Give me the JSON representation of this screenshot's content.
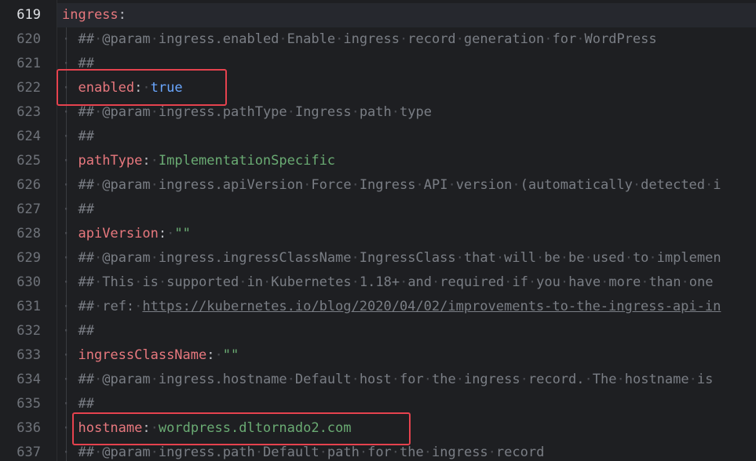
{
  "current_line": 619,
  "lines": [
    {
      "num": "619",
      "key": "ingress",
      "colon": ":",
      "indent": ""
    },
    {
      "num": "620",
      "comment": "## @param ingress.enabled Enable ingress record generation for WordPress"
    },
    {
      "num": "621",
      "comment": "##"
    },
    {
      "num": "622",
      "key": "enabled",
      "colon": ": ",
      "value": "true",
      "value_type": "bool"
    },
    {
      "num": "623",
      "comment": "## @param ingress.pathType Ingress path type"
    },
    {
      "num": "624",
      "comment": "##"
    },
    {
      "num": "625",
      "key": "pathType",
      "colon": ": ",
      "value": "ImplementationSpecific",
      "value_type": "string"
    },
    {
      "num": "626",
      "comment": "## @param ingress.apiVersion Force Ingress API version (automatically detected i"
    },
    {
      "num": "627",
      "comment": "##"
    },
    {
      "num": "628",
      "key": "apiVersion",
      "colon": ": ",
      "value": "\"\"",
      "value_type": "string"
    },
    {
      "num": "629",
      "comment": "## @param ingress.ingressClassName IngressClass that will be be used to implemen"
    },
    {
      "num": "630",
      "comment": "## This is supported in Kubernetes 1.18+ and required if you have more than one"
    },
    {
      "num": "631",
      "comment": "## ref: ",
      "link": "https://kubernetes.io/blog/2020/04/02/improvements-to-the-ingress-api-in"
    },
    {
      "num": "632",
      "comment": "##"
    },
    {
      "num": "633",
      "key": "ingressClassName",
      "colon": ": ",
      "value": "\"\"",
      "value_type": "string"
    },
    {
      "num": "634",
      "comment": "## @param ingress.hostname Default host for the ingress record. The hostname is"
    },
    {
      "num": "635",
      "comment": "##"
    },
    {
      "num": "636",
      "key": "hostname",
      "colon": ": ",
      "value": "wordpress.dltornado2.com",
      "value_type": "string"
    },
    {
      "num": "637",
      "comment": "## @param ingress.path Default path for the ingress record"
    }
  ],
  "colors": {
    "background": "#1e1f22",
    "key": "#e8787e",
    "comment": "#7a7e85",
    "bool": "#6aa7ff",
    "string": "#6aab73",
    "highlight_box": "#e5424e"
  }
}
